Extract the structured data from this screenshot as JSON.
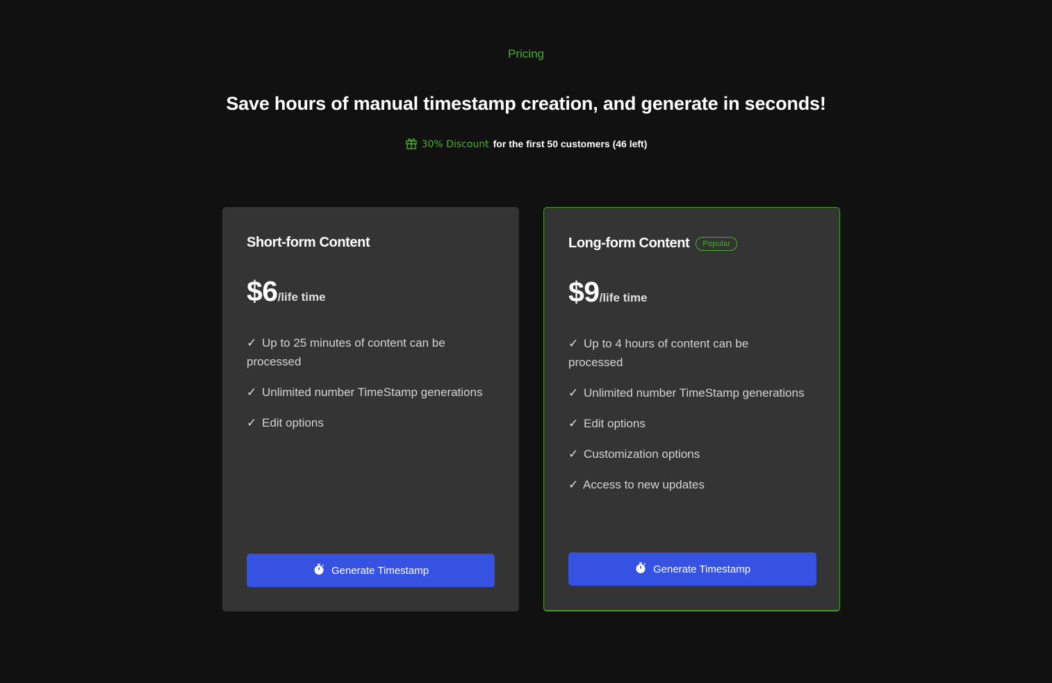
{
  "header": {
    "eyebrow": "Pricing",
    "headline": "Save hours of manual timestamp creation, and generate in seconds!",
    "discount_label": "30% Discount",
    "discount_text": "for the first 50 customers (46 left)",
    "discount_icon": "gift-icon"
  },
  "plans": [
    {
      "title": "Short-form Content",
      "price": "$6",
      "period": "/life time",
      "features": [
        "Up to 25 minutes of content can be processed",
        "Unlimited number TimeStamp generations",
        "Edit options"
      ],
      "cta_label": "Generate Timestamp",
      "cta_icon": "stopwatch-icon"
    },
    {
      "title": "Long-form Content",
      "badge": "Popular",
      "price": "$9",
      "period": "/life time",
      "features": [
        "Up to 4 hours of content can be processed",
        "Unlimited number TimeStamp generations",
        "Edit options",
        "Customization options",
        "Access to new updates"
      ],
      "cta_label": "Generate Timestamp",
      "cta_icon": "stopwatch-icon"
    }
  ],
  "check_glyph": "✓",
  "colors": {
    "accent_green": "#4caf2a",
    "button_blue": "#3652e3",
    "card_bg": "#343434",
    "page_bg": "#111111"
  }
}
